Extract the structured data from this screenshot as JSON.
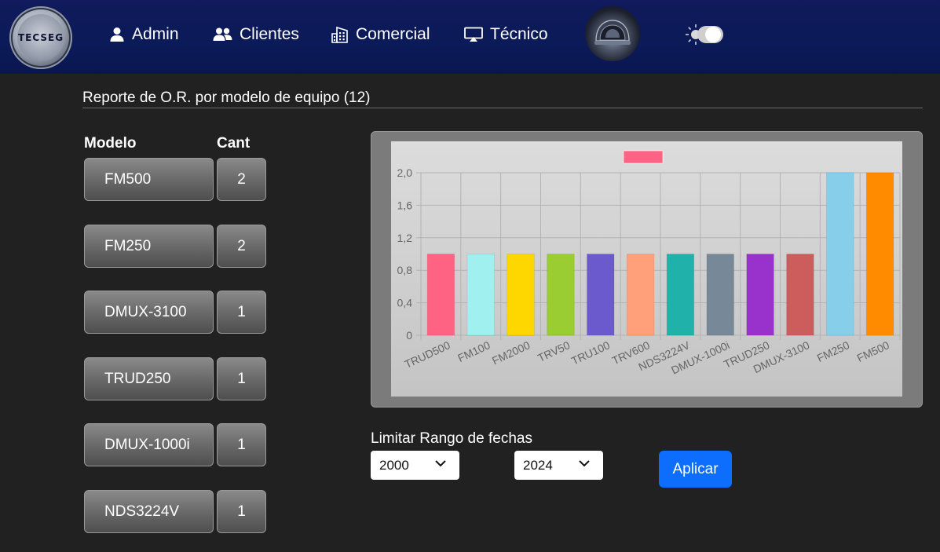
{
  "nav": {
    "logo_text": "TECSEG",
    "items": [
      {
        "label": "Admin",
        "icon": "user-icon"
      },
      {
        "label": "Clientes",
        "icon": "users-icon"
      },
      {
        "label": "Comercial",
        "icon": "building-icon"
      },
      {
        "label": "Técnico",
        "icon": "monitor-icon"
      }
    ],
    "theme_toggle": "sun-toggle-icon"
  },
  "report": {
    "title": "Reporte de O.R. por modelo de equipo (12)"
  },
  "table": {
    "headers": {
      "model": "Modelo",
      "count": "Cant"
    },
    "rows": [
      {
        "model": "FM500",
        "count": "2"
      },
      {
        "model": "FM250",
        "count": "2"
      },
      {
        "model": "DMUX-3100",
        "count": "1"
      },
      {
        "model": "TRUD250",
        "count": "1"
      },
      {
        "model": "DMUX-1000i",
        "count": "1"
      },
      {
        "model": "NDS3224V",
        "count": "1"
      }
    ]
  },
  "chart_data": {
    "type": "bar",
    "categories": [
      "TRUD500",
      "FM100",
      "FM2000",
      "TRV50",
      "TRU100",
      "TRV600",
      "NDS3224V",
      "DMUX-1000i",
      "TRUD250",
      "DMUX-3100",
      "FM250",
      "FM500"
    ],
    "values": [
      1,
      1,
      1,
      1,
      1,
      1,
      1,
      1,
      1,
      1,
      2,
      2
    ],
    "colors": [
      "#ff6384",
      "#a0f0f0",
      "#ffd700",
      "#9acd32",
      "#6a5acd",
      "#ffa07a",
      "#20b2aa",
      "#778899",
      "#9932cc",
      "#cd5c5c",
      "#87ceeb",
      "#ff8c00"
    ],
    "yticks": [
      "0",
      "0,4",
      "0,8",
      "1,2",
      "1,6",
      "2,0"
    ],
    "ylim": [
      0,
      2
    ],
    "legend_color": "#ff6384",
    "grid": true
  },
  "filters": {
    "label": "Limitar Rango de fechas",
    "from_value": "2000",
    "to_value": "2024",
    "apply_label": "Aplicar"
  }
}
